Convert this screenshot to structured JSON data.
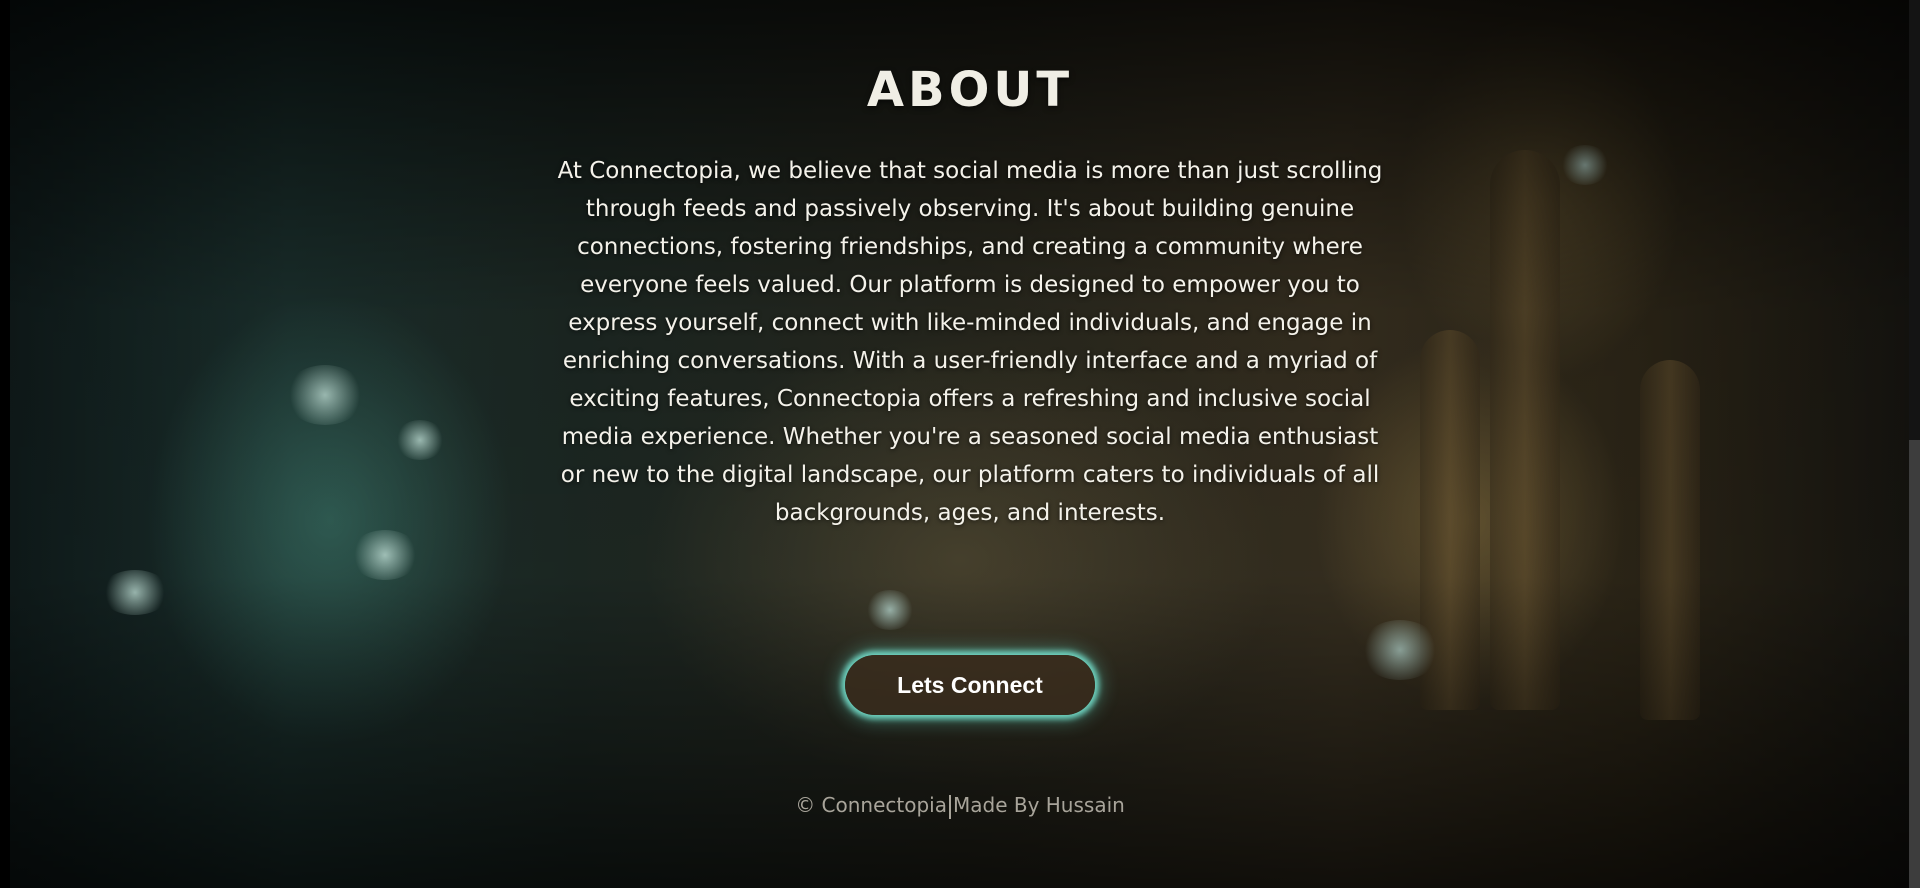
{
  "about": {
    "title": "ABOUT",
    "text": "At Connectopia, we believe that social media is more than just scrolling through feeds and passively observing. It's about building genuine connections, fostering friendships, and creating a community where everyone feels valued. Our platform is designed to empower you to express yourself, connect with like-minded individuals, and engage in enriching conversations. With a user-friendly interface and a myriad of exciting features, Connectopia offers a refreshing and inclusive social media experience. Whether you're a seasoned social media enthusiast or new to the digital landscape, our platform caters to individuals of all backgrounds, ages, and interests."
  },
  "cta": {
    "label": "Lets Connect"
  },
  "footer": {
    "copyright": "© Connectopia",
    "credit": "Made By Hussain"
  },
  "colors": {
    "button_glow": "#78e6d2",
    "footer_text": "#a8a49a"
  }
}
